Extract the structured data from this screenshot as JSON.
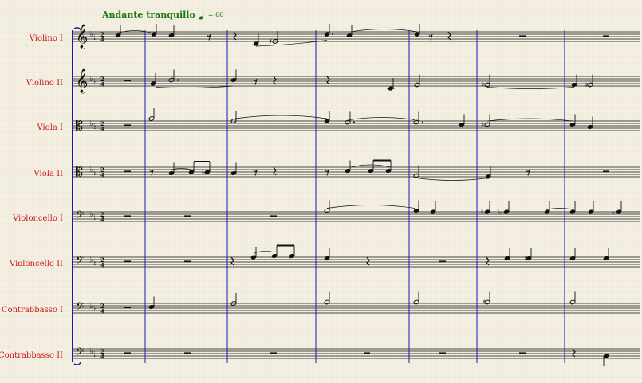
{
  "score": {
    "tempo": {
      "text": "Andante tranquillo",
      "equals": "= 66"
    },
    "time_signature": {
      "numerator": "2",
      "denominator": "4"
    },
    "key_signature": "B-flat major (2 flats)",
    "colors": {
      "part_labels": "#cc1a1a",
      "tempo": "#1a7a12",
      "barlines": "#1a1ab4",
      "staff": "#111111"
    },
    "parts": [
      {
        "name": "Violino I",
        "clef": "treble-clef-icon"
      },
      {
        "name": "Violino II",
        "clef": "treble-clef-icon"
      },
      {
        "name": "Viola I",
        "clef": "alto-clef-icon"
      },
      {
        "name": "Viola II",
        "clef": "alto-clef-icon"
      },
      {
        "name": "Violoncello I",
        "clef": "bass-clef-icon"
      },
      {
        "name": "Violoncello II",
        "clef": "bass-clef-icon"
      },
      {
        "name": "Contrabbasso  I",
        "clef": "bass-clef-icon"
      },
      {
        "name": "Contrabbasso II",
        "clef": "bass-clef-icon"
      }
    ],
    "measure_count": 7
  }
}
